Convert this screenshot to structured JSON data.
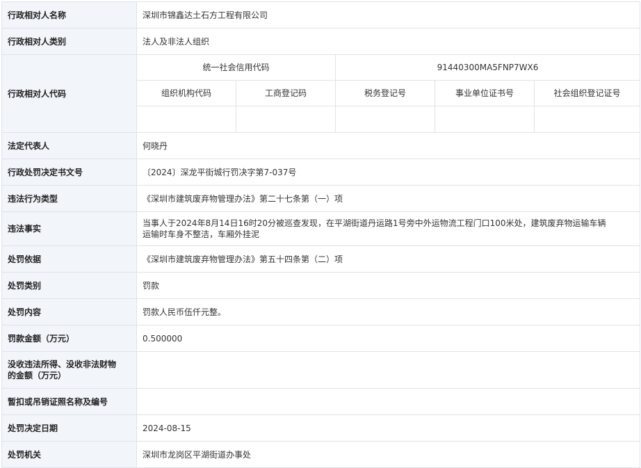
{
  "rows": {
    "name": {
      "label": "行政相对人名称",
      "value": "深圳市锦鑫达土石方工程有限公司"
    },
    "category": {
      "label": "行政相对人类别",
      "value": "法人及非法人组织"
    },
    "code": {
      "label": "行政相对人代码",
      "credit_code_label": "统一社会信用代码",
      "credit_code_value": "91440300MA5FNP7WX6",
      "sub_headers": [
        "组织机构代码",
        "工商登记码",
        "税务登记号",
        "事业单位证书号",
        "社会组织登记证号"
      ],
      "sub_values": [
        "",
        "",
        "",
        "",
        ""
      ]
    },
    "legal_rep": {
      "label": "法定代表人",
      "value": "何晓丹"
    },
    "decision_no": {
      "label": "行政处罚决定书文号",
      "value": "〔2024〕深龙平街城行罚决字第7-037号"
    },
    "violation_type": {
      "label": "违法行为类型",
      "value": "《深圳市建筑废弃物管理办法》第二十七条第（一）项"
    },
    "facts": {
      "label": "违法事实",
      "line1": "当事人于2024年8月14日16时20分被巡查发现，在平湖街道丹运路1号旁中外运物流工程门口100米处，建筑废弃物运输车辆",
      "line2": "运输时车身不整洁，车厢外挂泥"
    },
    "basis": {
      "label": "处罚依据",
      "value": "《深圳市建筑废弃物管理办法》第五十四条第（二）项"
    },
    "penalty_type": {
      "label": "处罚类别",
      "value": "罚款"
    },
    "penalty_content": {
      "label": "处罚内容",
      "value": "罚款人民币伍仟元整。"
    },
    "fine": {
      "label": "罚款金额（万元）",
      "value": "0.500000"
    },
    "confiscation": {
      "label_line1": "没收违法所得、没收非法财物",
      "label_line2": "的金额（万元）",
      "value": ""
    },
    "license": {
      "label": "暂扣或吊销证照名称及编号",
      "value": ""
    },
    "date": {
      "label": "处罚决定日期",
      "value": "2024-08-15"
    },
    "authority": {
      "label": "处罚机关",
      "value": "深圳市龙岗区平湖街道办事处"
    }
  }
}
